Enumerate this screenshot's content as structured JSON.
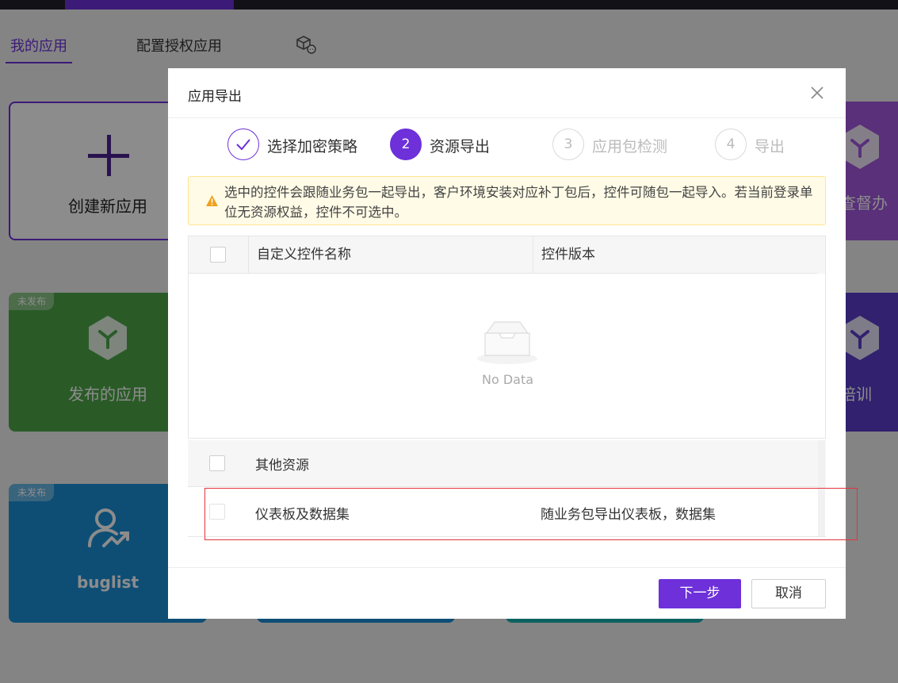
{
  "page": {
    "tabs": [
      {
        "label": "我的应用",
        "active": true
      },
      {
        "label": "配置授权应用",
        "active": false
      }
    ],
    "cards": {
      "create_label": "创建新应用",
      "published_label": "发布的应用",
      "buglist_label": "buglist",
      "unpublished_badge": "未发布",
      "right_card_1": "查督办",
      "right_card_2": "培训"
    }
  },
  "modal": {
    "title": "应用导出",
    "steps": [
      {
        "number": "1",
        "label": "选择加密策略",
        "state": "done"
      },
      {
        "number": "2",
        "label": "资源导出",
        "state": "active"
      },
      {
        "number": "3",
        "label": "应用包检测",
        "state": "pending"
      },
      {
        "number": "4",
        "label": "导出",
        "state": "pending"
      }
    ],
    "alert": "选中的控件会跟随业务包一起导出，客户环境安装对应补丁包后，控件可随包一起导入。若当前登录单位无资源权益，控件不可选中。",
    "table": {
      "columns": [
        "自定义控件名称",
        "控件版本"
      ],
      "empty_text": "No Data"
    },
    "other_resources": {
      "title": "其他资源",
      "rows": [
        {
          "name": "仪表板及数据集",
          "description": "随业务包导出仪表板，数据集"
        }
      ]
    },
    "buttons": {
      "next": "下一步",
      "cancel": "取消"
    }
  },
  "colors": {
    "accent": "#6d30d9",
    "highlight_border": "#e3343b",
    "alert_bg": "#fffbe6"
  }
}
